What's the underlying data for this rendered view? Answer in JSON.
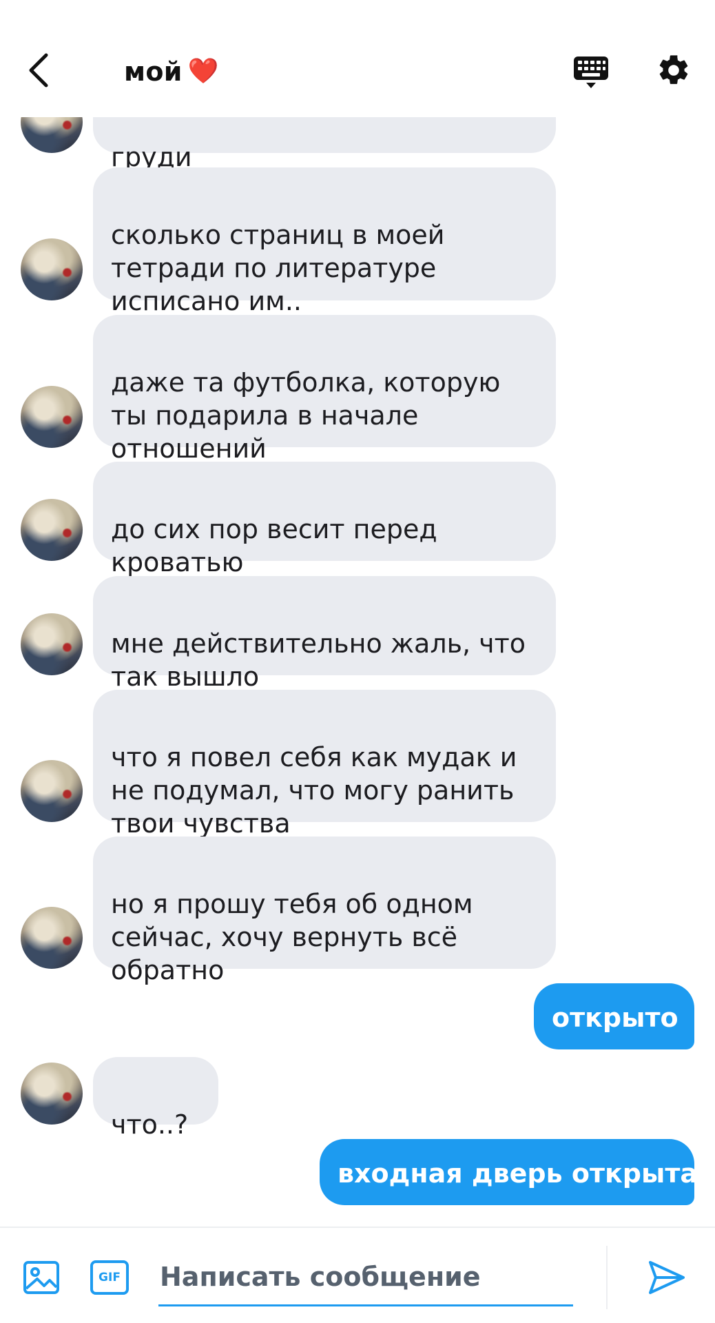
{
  "header": {
    "title": "мой",
    "title_emoji": "❤️",
    "back_icon": "chevron-left-icon",
    "keyboard_icon": "keyboard-icon",
    "settings_icon": "gear-icon"
  },
  "messages": [
    {
      "side": "in",
      "text": "груди"
    },
    {
      "side": "in",
      "text": "сколько страниц в моей\nтетради по литературе\nисписано им.."
    },
    {
      "side": "in",
      "text": "даже та футболка, которую\nты подарила в начале\nотношений"
    },
    {
      "side": "in",
      "text": "до сих пор весит перед\nкроватью"
    },
    {
      "side": "in",
      "text": "мне действительно жаль, что\nтак вышло"
    },
    {
      "side": "in",
      "text": "что я повел себя как мудак и\nне подумал, что могу ранить\nтвои чувства"
    },
    {
      "side": "in",
      "text": "но я прошу тебя об одном\nсейчас, хочу вернуть всё\nобратно"
    },
    {
      "side": "out",
      "text": "открыто"
    },
    {
      "side": "in",
      "text": "что..?"
    },
    {
      "side": "out",
      "text": "входная дверь открыта"
    }
  ],
  "composer": {
    "placeholder": "Написать сообщение",
    "gif_label": "GIF",
    "image_icon": "image-icon",
    "send_icon": "send-icon"
  },
  "colors": {
    "accent": "#1d9bf0",
    "incoming_bubble": "#e9ebf0",
    "outgoing_text": "#ffffff"
  }
}
